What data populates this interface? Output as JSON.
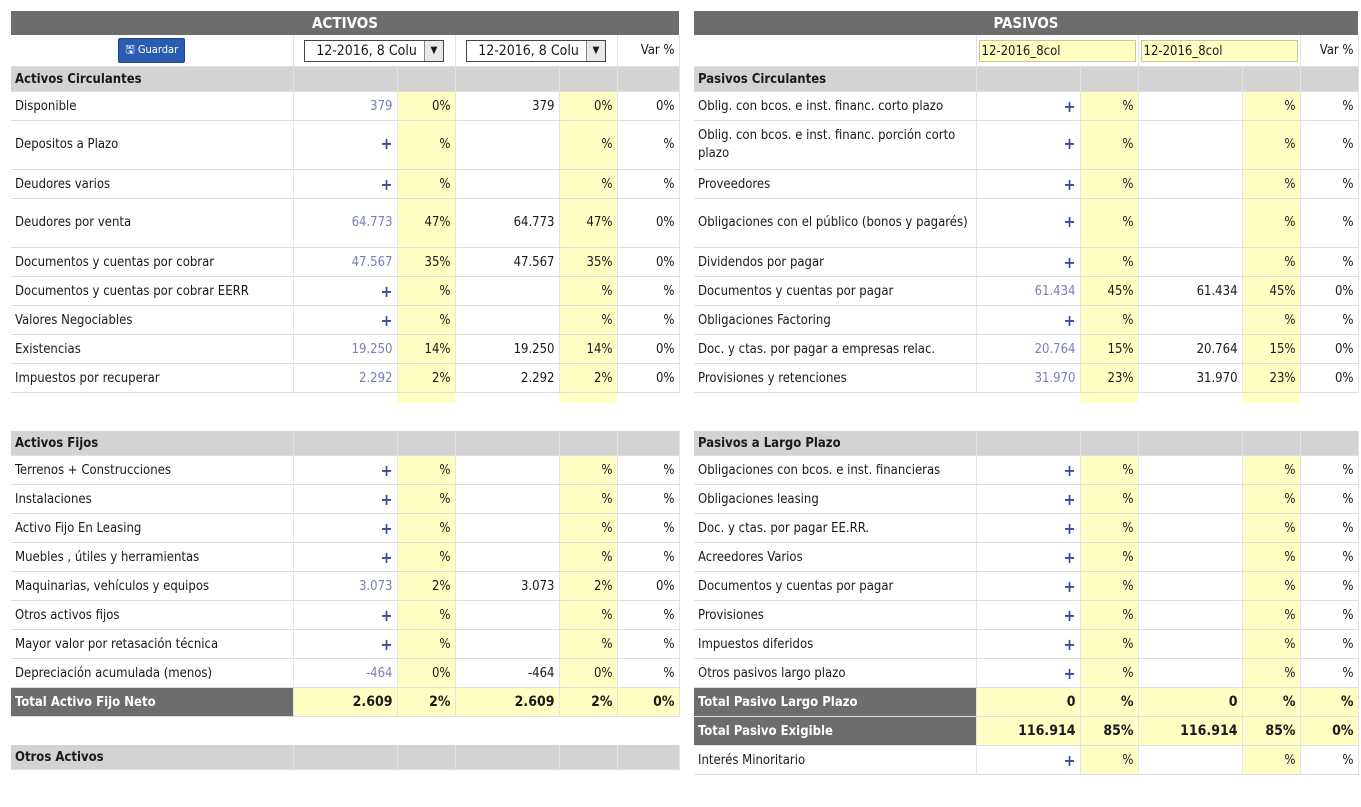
{
  "activos": {
    "title": "ACTIVOS",
    "save_label": "Guardar",
    "period_a": "12-2016, 8 Colu",
    "period_b": "12-2016, 8 Colu",
    "var_label": "Var %",
    "sections": [
      {
        "title": "Activos Circulantes",
        "rows": [
          {
            "label": "Disponible",
            "a": "379",
            "pa": "0%",
            "b": "379",
            "pb": "0%",
            "v": "0%"
          },
          {
            "label": "Depositos a Plazo",
            "a": "+",
            "pa": "%",
            "b": "",
            "pb": "%",
            "v": "%"
          },
          {
            "label": "Deudores varios",
            "a": "+",
            "pa": "%",
            "b": "",
            "pb": "%",
            "v": "%"
          },
          {
            "label": "Deudores por venta",
            "a": "64.773",
            "pa": "47%",
            "b": "64.773",
            "pb": "47%",
            "v": "0%"
          },
          {
            "label": "Documentos y cuentas por cobrar",
            "a": "47.567",
            "pa": "35%",
            "b": "47.567",
            "pb": "35%",
            "v": "0%"
          },
          {
            "label": "Documentos y cuentas por cobrar EERR",
            "a": "+",
            "pa": "%",
            "b": "",
            "pb": "%",
            "v": "%"
          },
          {
            "label": "Valores Negociables",
            "a": "+",
            "pa": "%",
            "b": "",
            "pb": "%",
            "v": "%"
          },
          {
            "label": "Existencias",
            "a": "19.250",
            "pa": "14%",
            "b": "19.250",
            "pb": "14%",
            "v": "0%"
          },
          {
            "label": "Impuestos por recuperar",
            "a": "2.292",
            "pa": "2%",
            "b": "2.292",
            "pb": "2%",
            "v": "0%"
          }
        ]
      },
      {
        "title": "Activos Fijos",
        "rows": [
          {
            "label": "Terrenos + Construcciones",
            "a": "+",
            "pa": "%",
            "b": "",
            "pb": "%",
            "v": "%"
          },
          {
            "label": "Instalaciones",
            "a": "+",
            "pa": "%",
            "b": "",
            "pb": "%",
            "v": "%"
          },
          {
            "label": "Activo Fijo En Leasing",
            "a": "+",
            "pa": "%",
            "b": "",
            "pb": "%",
            "v": "%"
          },
          {
            "label": "Muebles , útiles y herramientas",
            "a": "+",
            "pa": "%",
            "b": "",
            "pb": "%",
            "v": "%"
          },
          {
            "label": "Maquinarias, vehículos y equipos",
            "a": "3.073",
            "pa": "2%",
            "b": "3.073",
            "pb": "2%",
            "v": "0%"
          },
          {
            "label": "Otros activos fijos",
            "a": "+",
            "pa": "%",
            "b": "",
            "pb": "%",
            "v": "%"
          },
          {
            "label": "Mayor valor por retasación técnica",
            "a": "+",
            "pa": "%",
            "b": "",
            "pb": "%",
            "v": "%"
          },
          {
            "label": "Depreciación acumulada (menos)",
            "a": "-464",
            "pa": "0%",
            "b": "-464",
            "pb": "0%",
            "v": "%"
          }
        ],
        "total": {
          "label": "Total Activo Fijo Neto",
          "a": "2.609",
          "pa": "2%",
          "b": "2.609",
          "pb": "2%",
          "v": "0%"
        }
      },
      {
        "title": "Otros Activos",
        "rows": []
      }
    ]
  },
  "pasivos": {
    "title": "PASIVOS",
    "period_a": "12-2016_8col",
    "period_b": "12-2016_8col",
    "var_label": "Var %",
    "sections": [
      {
        "title": "Pasivos Circulantes",
        "rows": [
          {
            "label": "Oblig. con bcos. e inst. financ. corto plazo",
            "a": "+",
            "pa": "%",
            "b": "",
            "pb": "%",
            "v": "%"
          },
          {
            "label": "Oblig. con bcos. e inst. financ. porción corto plazo",
            "a": "+",
            "pa": "%",
            "b": "",
            "pb": "%",
            "v": "%"
          },
          {
            "label": "Proveedores",
            "a": "+",
            "pa": "%",
            "b": "",
            "pb": "%",
            "v": "%"
          },
          {
            "label": "Obligaciones con el público (bonos y pagarés)",
            "a": "+",
            "pa": "%",
            "b": "",
            "pb": "%",
            "v": "%"
          },
          {
            "label": "Dividendos por pagar",
            "a": "+",
            "pa": "%",
            "b": "",
            "pb": "%",
            "v": "%"
          },
          {
            "label": "Documentos y cuentas por pagar",
            "a": "61.434",
            "pa": "45%",
            "b": "61.434",
            "pb": "45%",
            "v": "0%"
          },
          {
            "label": "Obligaciones Factoring",
            "a": "+",
            "pa": "%",
            "b": "",
            "pb": "%",
            "v": "%"
          },
          {
            "label": "Doc. y ctas. por pagar a empresas relac.",
            "a": "20.764",
            "pa": "15%",
            "b": "20.764",
            "pb": "15%",
            "v": "0%"
          },
          {
            "label": "Provisiones y retenciones",
            "a": "31.970",
            "pa": "23%",
            "b": "31.970",
            "pb": "23%",
            "v": "0%"
          }
        ]
      },
      {
        "title": "Pasivos a Largo Plazo",
        "rows": [
          {
            "label": "Obligaciones con bcos. e inst. financieras",
            "a": "+",
            "pa": "%",
            "b": "",
            "pb": "%",
            "v": "%"
          },
          {
            "label": "Obligaciones leasing",
            "a": "+",
            "pa": "%",
            "b": "",
            "pb": "%",
            "v": "%"
          },
          {
            "label": "Doc. y ctas. por pagar EE.RR.",
            "a": "+",
            "pa": "%",
            "b": "",
            "pb": "%",
            "v": "%"
          },
          {
            "label": "Acreedores Varios",
            "a": "+",
            "pa": "%",
            "b": "",
            "pb": "%",
            "v": "%"
          },
          {
            "label": "Documentos y cuentas por pagar",
            "a": "+",
            "pa": "%",
            "b": "",
            "pb": "%",
            "v": "%"
          },
          {
            "label": "Provisiones",
            "a": "+",
            "pa": "%",
            "b": "",
            "pb": "%",
            "v": "%"
          },
          {
            "label": "Impuestos diferidos",
            "a": "+",
            "pa": "%",
            "b": "",
            "pb": "%",
            "v": "%"
          },
          {
            "label": "Otros pasivos largo plazo",
            "a": "+",
            "pa": "%",
            "b": "",
            "pb": "%",
            "v": "%"
          }
        ],
        "total": {
          "label": "Total Pasivo Largo Plazo",
          "a": "0",
          "pa": "%",
          "b": "0",
          "pb": "%",
          "v": "%"
        },
        "total2": {
          "label": "Total Pasivo Exigible",
          "a": "116.914",
          "pa": "85%",
          "b": "116.914",
          "pb": "85%",
          "v": "0%"
        },
        "minority": {
          "label": "Interés Minoritario",
          "a": "+",
          "pa": "%",
          "b": "",
          "pb": "%",
          "v": "%"
        }
      }
    ]
  }
}
